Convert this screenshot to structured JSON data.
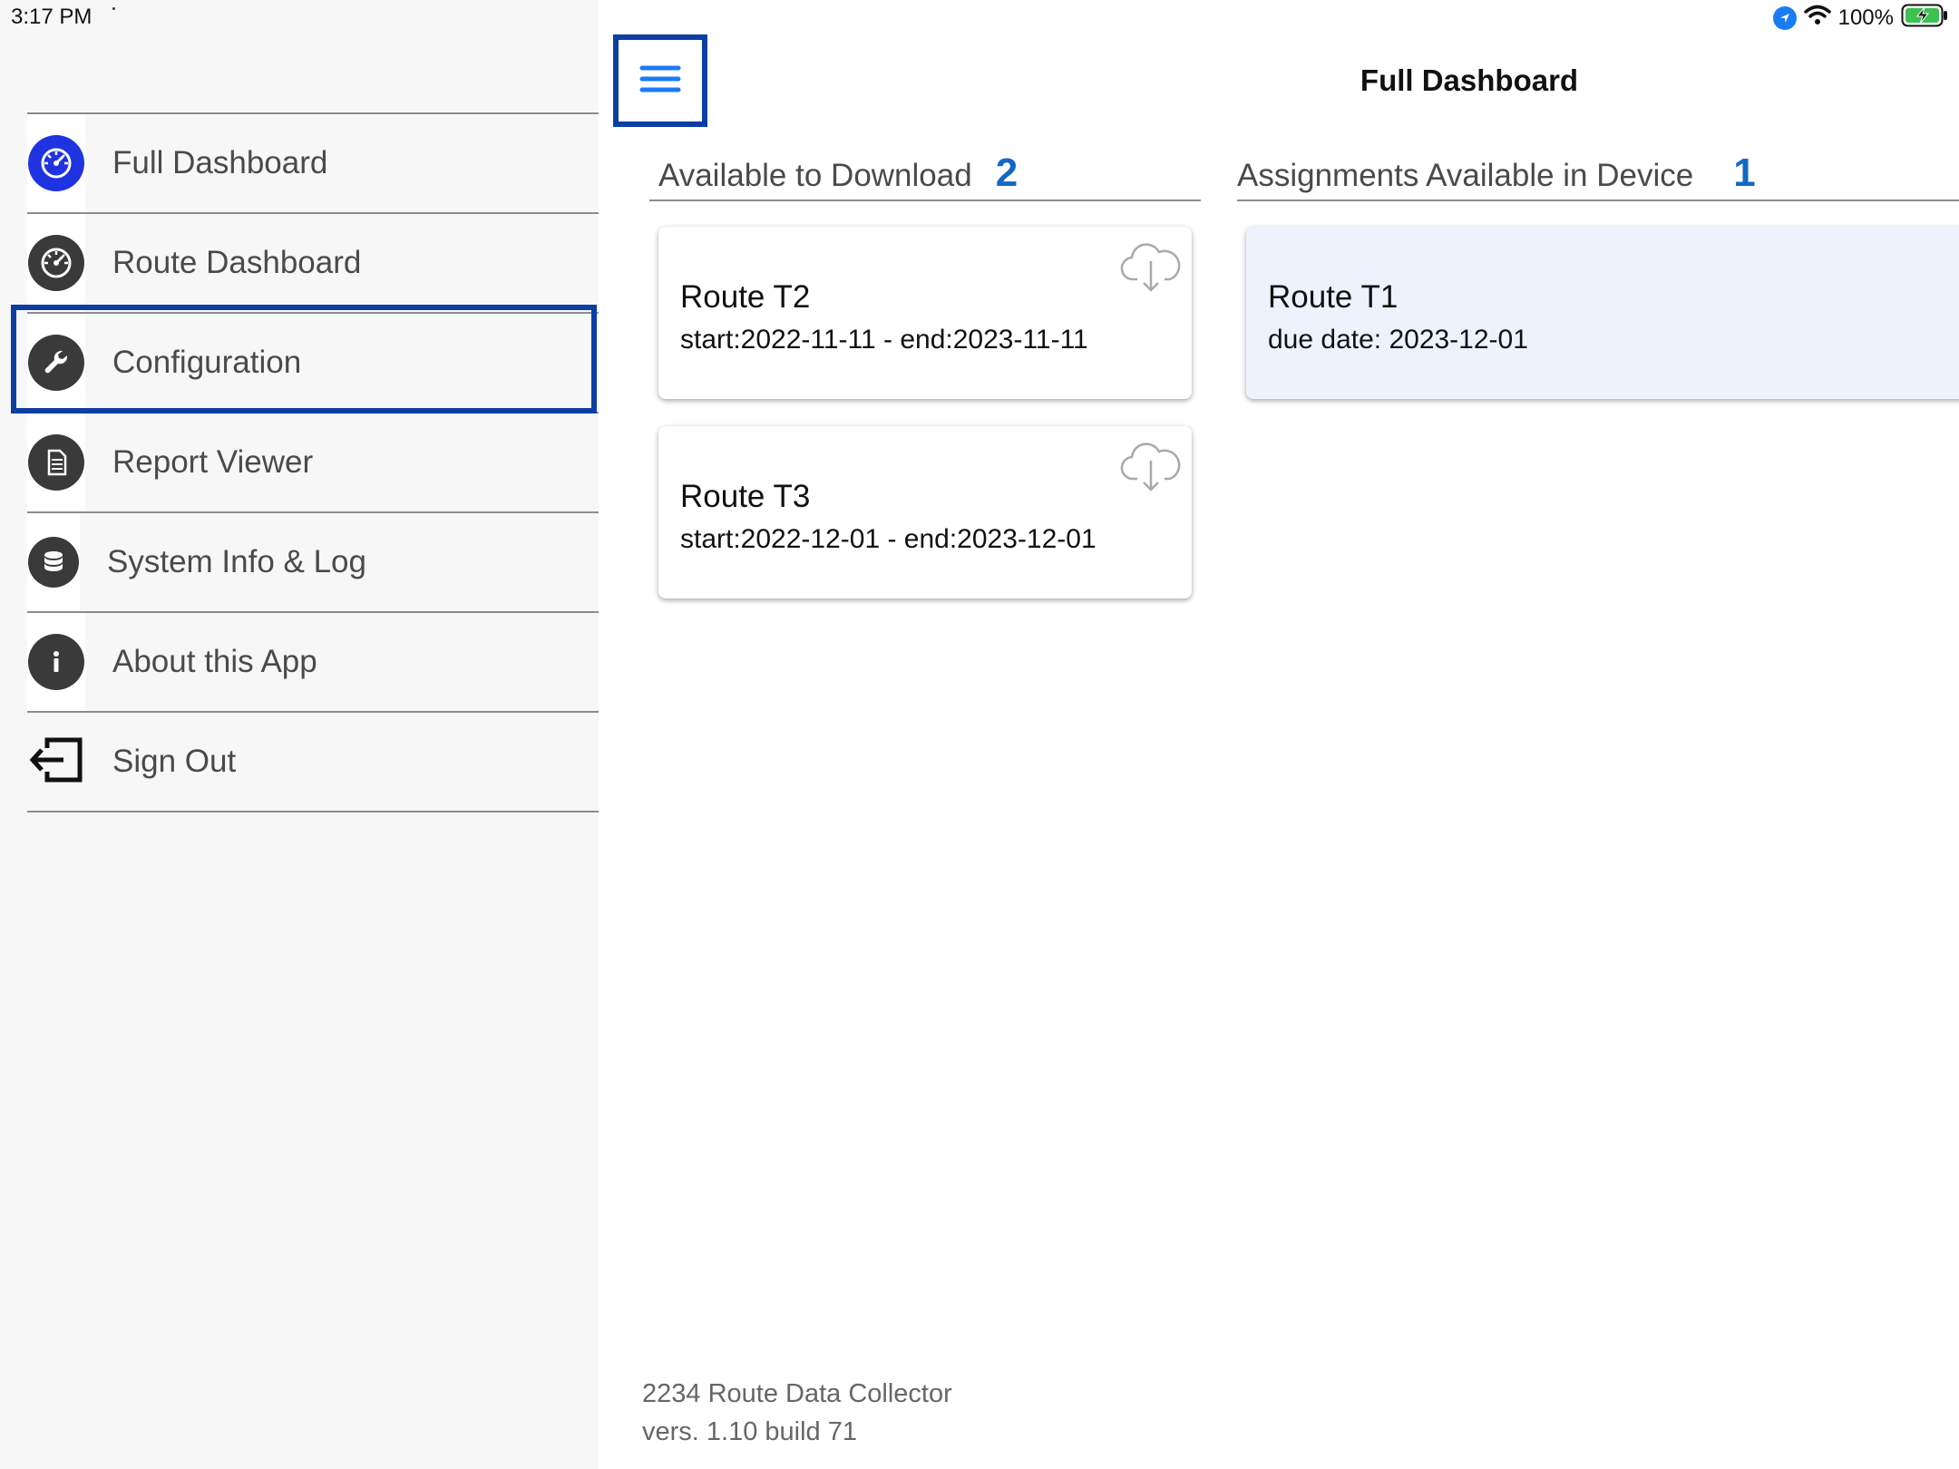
{
  "status_bar": {
    "time": "3:17 PM",
    "battery": "100%"
  },
  "sidebar": {
    "items": [
      {
        "label": "Full Dashboard",
        "icon": "speedometer-icon"
      },
      {
        "label": "Route Dashboard",
        "icon": "speedometer-icon"
      },
      {
        "label": "Configuration",
        "icon": "wrench-icon"
      },
      {
        "label": "Report Viewer",
        "icon": "document-icon"
      },
      {
        "label": "System Info & Log",
        "icon": "database-icon"
      },
      {
        "label": "About this App",
        "icon": "info-icon"
      },
      {
        "label": "Sign Out",
        "icon": "sign-out-icon"
      }
    ]
  },
  "header": {
    "title": "Full Dashboard"
  },
  "sections": {
    "download": {
      "title": "Available to Download",
      "count": "2",
      "cards": [
        {
          "title": "Route T2",
          "subtitle": "start:2022-11-11 - end:2023-11-11"
        },
        {
          "title": "Route T3",
          "subtitle": "start:2022-12-01 - end:2023-12-01"
        }
      ]
    },
    "device": {
      "title": "Assignments Available in Device",
      "count": "1",
      "cards": [
        {
          "title": "Route T1",
          "subtitle": "due date: 2023-12-01"
        }
      ]
    }
  },
  "footer": {
    "app_name": "2234 Route Data Collector",
    "version": "vers. 1.10 build 71"
  },
  "colors": {
    "accent": "#1468c4",
    "highlight_border": "#0b3ea3",
    "card_selected_bg": "#ecf3fd"
  }
}
